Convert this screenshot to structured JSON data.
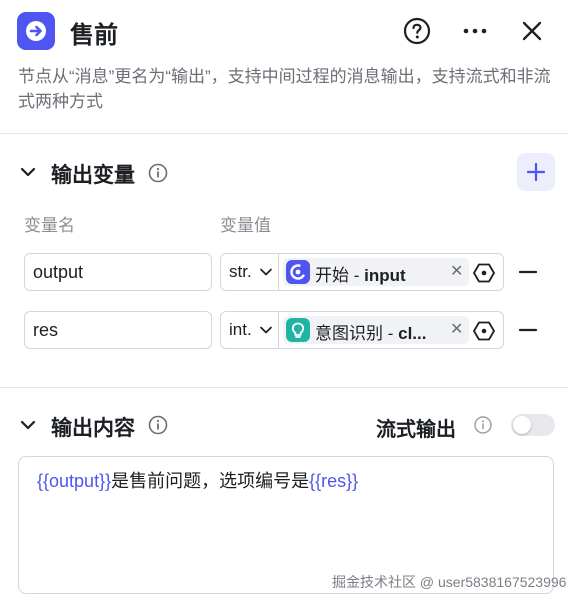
{
  "header": {
    "title": "售前",
    "help_icon": "question-circle-icon",
    "more_icon": "more-horizontal-icon",
    "close_icon": "close-icon",
    "accent": "#4f55f0"
  },
  "description": "节点从“消息”更名为“输出”，支持中间过程的消息输出，支持流式和非流式两种方式",
  "output_variables": {
    "title": "输出变量",
    "columns": {
      "name": "变量名",
      "value": "变量值"
    },
    "rows": [
      {
        "name": "output",
        "type": "str.",
        "ref_node": "开始",
        "ref_sep": " - ",
        "ref_var": "input",
        "ref_icon": "start-node-icon",
        "ref_icon_color": "#4f55f0"
      },
      {
        "name": "res",
        "type": "int.",
        "ref_node": "意图识别",
        "ref_sep": " - ",
        "ref_var": "cl...",
        "ref_icon": "intent-node-icon",
        "ref_icon_color": "#20b4a5"
      }
    ]
  },
  "output_content": {
    "title": "输出内容",
    "stream_label": "流式输出",
    "stream_enabled": false,
    "template": {
      "var1": "{{output}}",
      "text1": "是售前问题，选项编号是",
      "var2": "{{res}}"
    }
  },
  "watermark": "掘金技术社区 @ user5838167523996"
}
